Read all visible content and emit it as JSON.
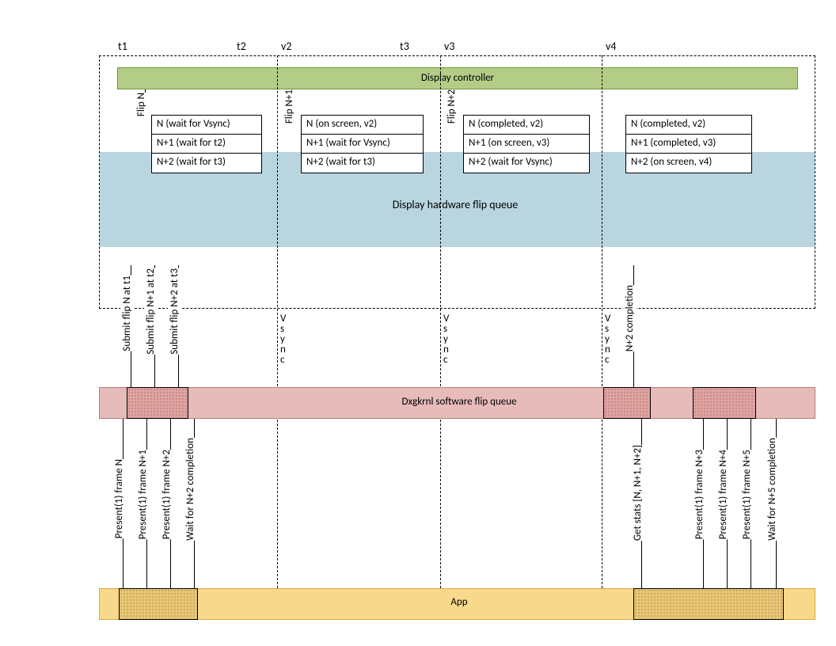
{
  "time_labels": {
    "t1": "t1",
    "t2": "t2",
    "v2": "v2",
    "t3": "t3",
    "v3": "v3",
    "v4": "v4"
  },
  "display_controller": "Display controller",
  "flip_queue_label": "Display hardware flip queue",
  "dxgkrnl_label": "Dxgkrnl software flip queue",
  "app_label": "App",
  "flip_labels": {
    "n": "Flip N",
    "n1": "Flip N+1",
    "n2": "Flip N+2"
  },
  "submit_labels": {
    "n": "Submit flip N at t1",
    "n1": "Submit flip N+1 at t2",
    "n2": "Submit flip N+2 at t3"
  },
  "vsync": "Vsync",
  "n2_completion": "N+2 completion",
  "queues": {
    "q1": {
      "r1": "N (wait for Vsync)",
      "r2": "N+1 (wait for t2)",
      "r3": "N+2 (wait for t3)"
    },
    "q2": {
      "r1": "N (on screen, v2)",
      "r2": "N+1 (wait for Vsync)",
      "r3": "N+2 (wait for t3)"
    },
    "q3": {
      "r1": "N (completed, v2)",
      "r2": "N+1 (on screen, v3)",
      "r3": "N+2 (wait for Vsync)"
    },
    "q4": {
      "r1": "N (completed, v2)",
      "r2": "N+1 (completed, v3)",
      "r3": "N+2 (on screen, v4)"
    }
  },
  "present": {
    "n": "Present(1) frame N",
    "n1": "Present(1) frame N+1",
    "n2": "Present(1) frame N+2",
    "wait_n2": "Wait for N+2 completion",
    "stats": "Get stats [N, N+1, N+2]",
    "n3": "Present(1) frame N+3",
    "n4": "Present(1) frame N+4",
    "n5": "Present(1) frame N+5",
    "wait_n5": "Wait for N+5 completion"
  }
}
